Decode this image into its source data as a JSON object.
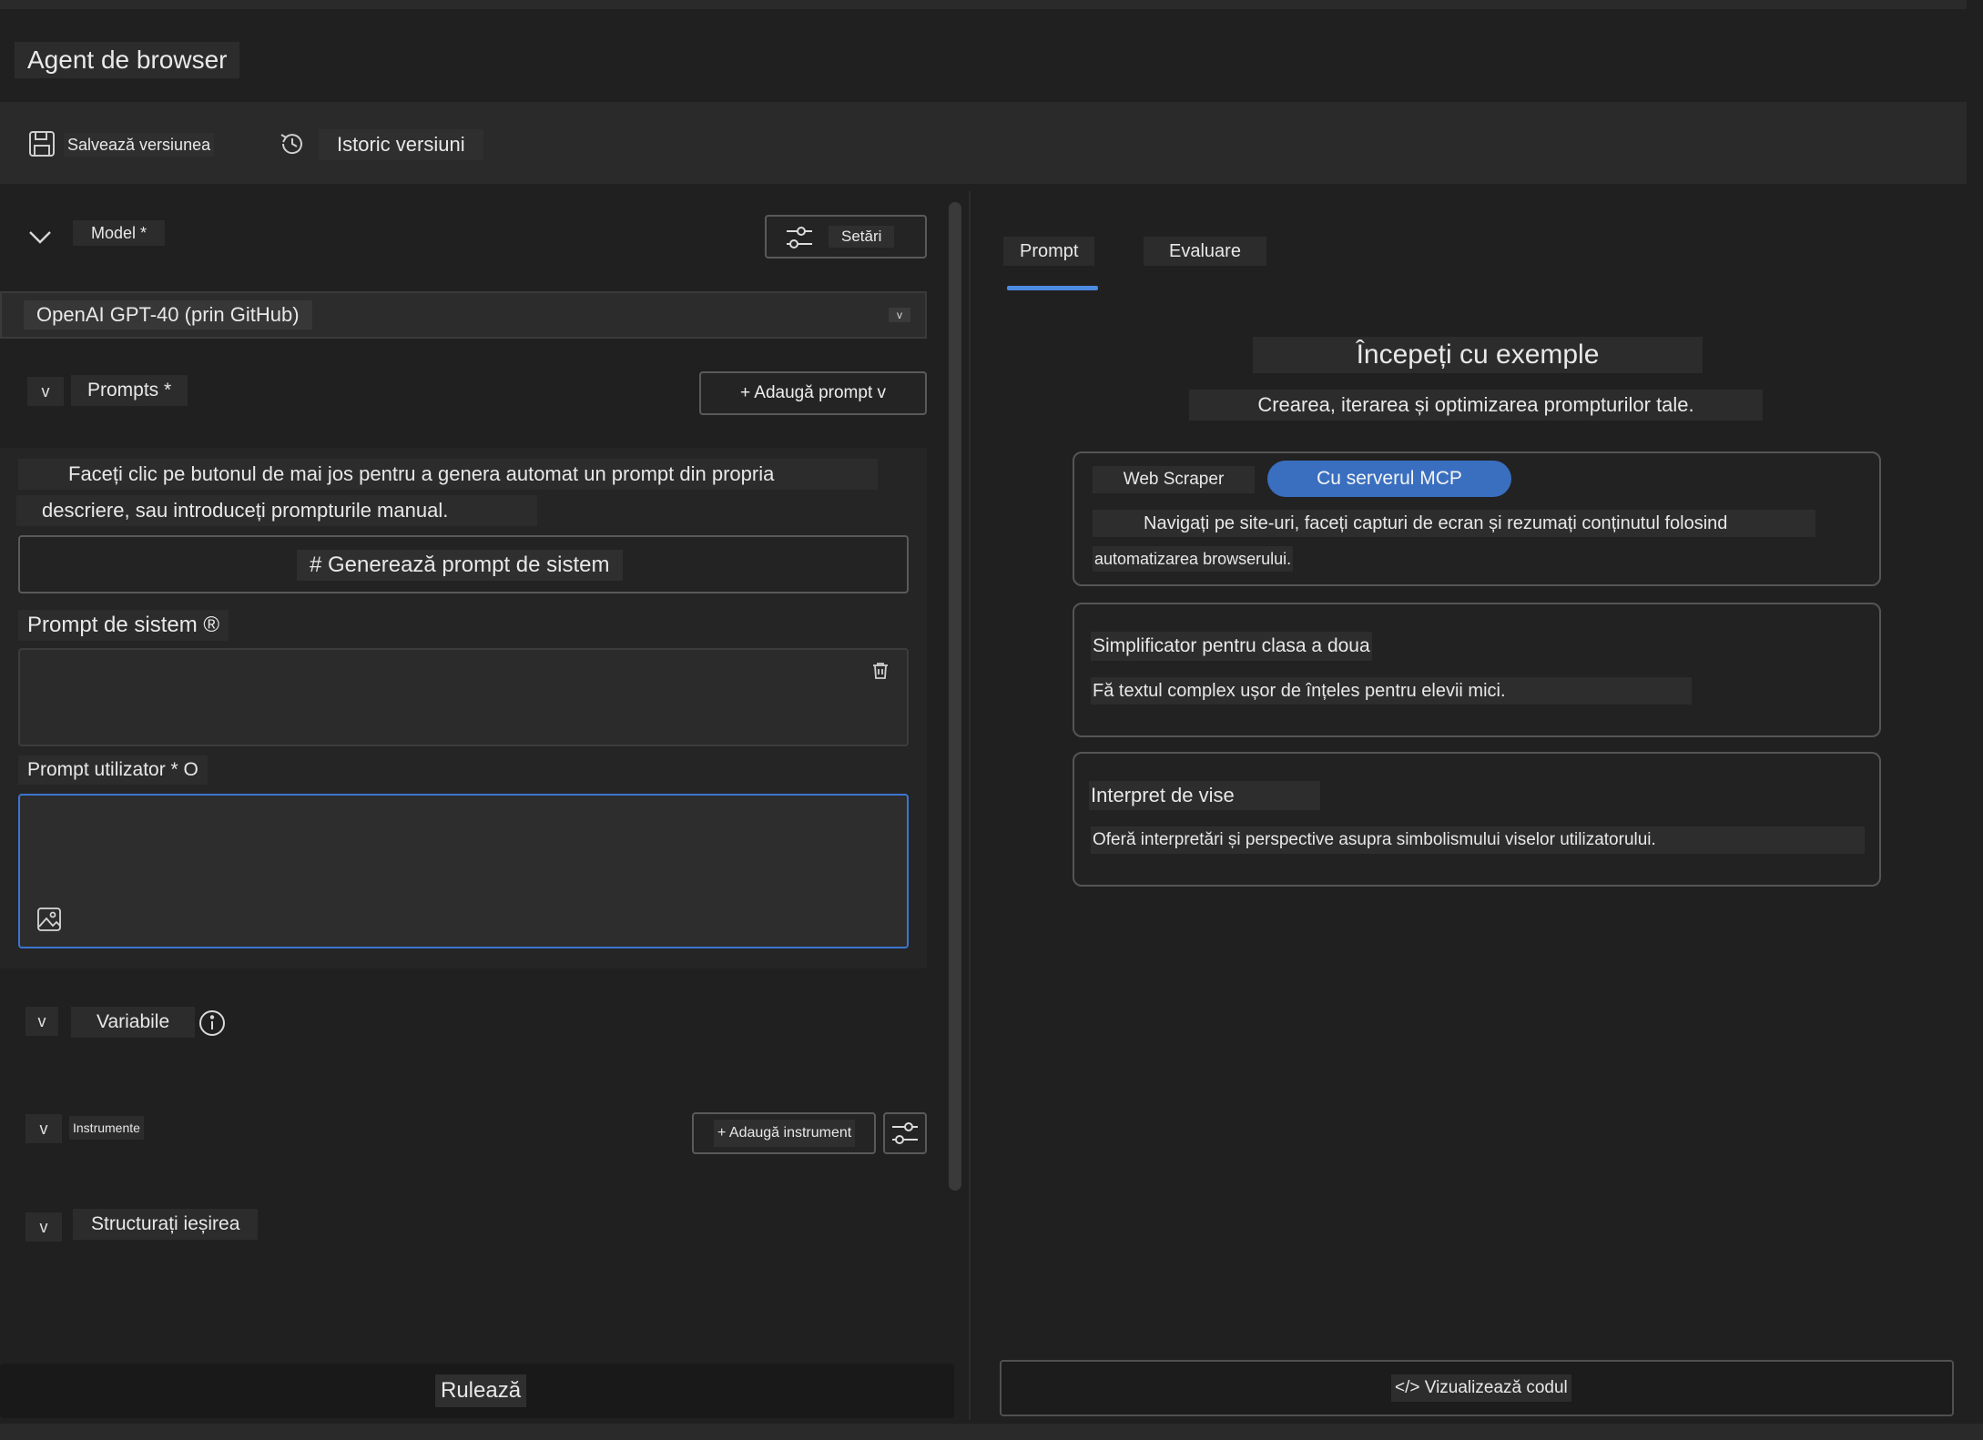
{
  "app": {
    "title": "Agent de browser"
  },
  "toolbar": {
    "save_icon": "save-icon",
    "save_label": "Salvează versiunea",
    "history_icon": "history-icon",
    "history_label": "Istoric versiuni"
  },
  "model": {
    "toggle": "chevron-down-icon",
    "label": "Model *",
    "settings_label": "Setări",
    "selected": "OpenAI GPT-40 (prin GitHub)",
    "caret": "v"
  },
  "prompts": {
    "toggle": "v",
    "label": "Prompts *",
    "add_button": "+ Adaugă prompt v",
    "description_line1": "Faceți clic pe butonul de mai jos pentru a genera automat un prompt din propria",
    "description_line2": "descriere, sau introduceți prompturile manual.",
    "generate_button": "# Generează prompt de sistem",
    "system_label": "Prompt de sistem ®",
    "system_value": "",
    "user_label": "Prompt utilizator * O",
    "user_value": ""
  },
  "variables": {
    "toggle": "v",
    "label": "Variabile"
  },
  "tools": {
    "toggle": "v",
    "label": "Instrumente",
    "add_button": "+ Adaugă instrument"
  },
  "structured_output": {
    "toggle": "v",
    "label": "Structurați ieșirea"
  },
  "run_button": "Rulează",
  "tabs": [
    {
      "label": "Prompt",
      "active": true
    },
    {
      "label": "Evaluare",
      "active": false
    }
  ],
  "examples": {
    "title": "Începeți cu exemple",
    "subtitle": "Crearea, iterarea și optimizarea prompturilor tale.",
    "cards": [
      {
        "tags": [
          "Web Scraper",
          "Cu serverul MCP"
        ],
        "description_line1": "Navigați pe site-uri, faceți capturi de ecran și rezumați conținutul folosind",
        "description_line2": "automatizarea browserului."
      },
      {
        "title": "Simplificator pentru clasa a doua",
        "description": "Fă textul complex ușor de înțeles pentru elevii mici."
      },
      {
        "title": "Interpret de vise",
        "description": "Oferă interpretări și perspective asupra simbolismului viselor utilizatorului."
      }
    ]
  },
  "view_code_button": "</> Vizualizează codul",
  "colors": {
    "background": "#202020",
    "panel": "#2a2a2a",
    "accent": "#3b76d0",
    "chip_active": "#3a6fc0"
  }
}
